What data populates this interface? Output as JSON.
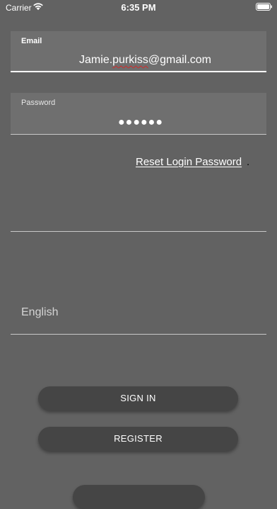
{
  "status_bar": {
    "carrier": "Carrier",
    "time": "6:35 PM"
  },
  "email_field": {
    "label": "Email",
    "value_part1": "Jamie.",
    "value_part2": "purkiss",
    "value_part3": "@gmail.com"
  },
  "password_field": {
    "label": "Password",
    "value": "●●●●●●"
  },
  "reset_link": {
    "text": "Reset Login Password",
    "trailing": "."
  },
  "language": {
    "value": "English"
  },
  "buttons": {
    "sign_in": "SIGN IN",
    "register": "REGISTER"
  },
  "colors": {
    "background": "#626262",
    "field_background": "#6f6f6f",
    "button_background": "#454545",
    "spellcheck": "#d22a2a"
  },
  "icons": {
    "wifi": "wifi-icon",
    "battery": "battery-icon"
  }
}
